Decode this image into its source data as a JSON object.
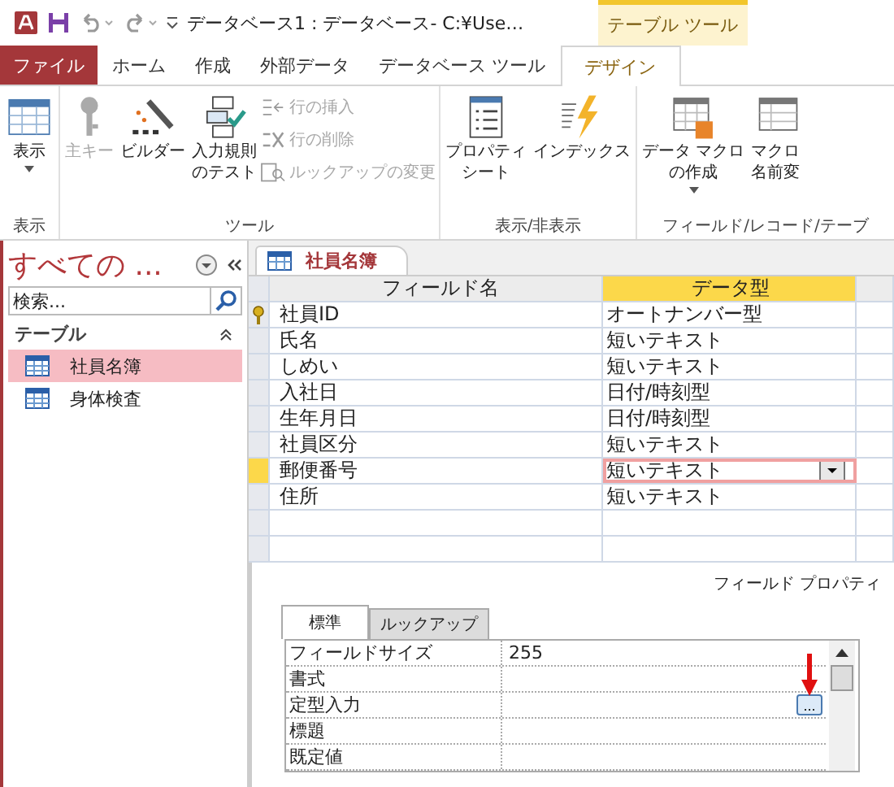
{
  "title_bar": {
    "title": "データベース1 : データベース- C:¥Use…",
    "context_tab": "テーブル ツール"
  },
  "ribbon_tabs": [
    {
      "label": "ファイル",
      "kind": "file",
      "selected": false
    },
    {
      "label": "ホーム",
      "kind": "tab",
      "selected": false
    },
    {
      "label": "作成",
      "kind": "tab",
      "selected": false
    },
    {
      "label": "外部データ",
      "kind": "tab",
      "selected": false
    },
    {
      "label": "データベース ツール",
      "kind": "tab",
      "selected": false
    },
    {
      "label": "デザイン",
      "kind": "tab",
      "selected": true
    }
  ],
  "ribbon_groups": [
    {
      "label": "表示",
      "buttons": [
        {
          "label": [
            "表示"
          ],
          "kind": "large",
          "disabled": false,
          "dropdown": true
        }
      ]
    },
    {
      "label": "ツール",
      "buttons": [
        {
          "label": [
            "主キー"
          ],
          "kind": "large",
          "disabled": true
        },
        {
          "label": [
            "ビルダー"
          ],
          "kind": "large",
          "disabled": false
        },
        {
          "label": [
            "入力規則",
            "のテスト"
          ],
          "kind": "large",
          "disabled": false
        },
        {
          "label": [
            "行の挿入"
          ],
          "kind": "small",
          "disabled": true
        },
        {
          "label": [
            "行の削除"
          ],
          "kind": "small",
          "disabled": true
        },
        {
          "label": [
            "ルックアップの変更"
          ],
          "kind": "small",
          "disabled": true
        }
      ]
    },
    {
      "label": "表示/非表示",
      "buttons": [
        {
          "label": [
            "プロパティ",
            "シート"
          ],
          "kind": "large",
          "disabled": false
        },
        {
          "label": [
            "インデックス"
          ],
          "kind": "large",
          "disabled": false
        }
      ]
    },
    {
      "label": "フィールド/レコード/テーブ",
      "buttons": [
        {
          "label": [
            "データ マクロ",
            "の作成"
          ],
          "kind": "large",
          "disabled": false,
          "dropdown": true
        },
        {
          "label": [
            "マクロ",
            "名前変"
          ],
          "kind": "large",
          "disabled": false
        }
      ]
    }
  ],
  "nav_pane": {
    "title": "すべての ...",
    "search": {
      "placeholder": "検索..."
    },
    "section": "テーブル",
    "items": [
      {
        "label": "社員名簿",
        "selected": true
      },
      {
        "label": "身体検査",
        "selected": false
      }
    ]
  },
  "document_tab": "社員名簿",
  "table": {
    "columns": [
      "フィールド名",
      "データ型"
    ],
    "rows": [
      {
        "field": "社員ID",
        "type": "オートナンバー型",
        "primary_key": true,
        "selected": false
      },
      {
        "field": "氏名",
        "type": "短いテキスト",
        "primary_key": false,
        "selected": false
      },
      {
        "field": "しめい",
        "type": "短いテキスト",
        "primary_key": false,
        "selected": false
      },
      {
        "field": "入社日",
        "type": "日付/時刻型",
        "primary_key": false,
        "selected": false
      },
      {
        "field": "生年月日",
        "type": "日付/時刻型",
        "primary_key": false,
        "selected": false
      },
      {
        "field": "社員区分",
        "type": "短いテキスト",
        "primary_key": false,
        "selected": false
      },
      {
        "field": "郵便番号",
        "type": "短いテキスト",
        "primary_key": false,
        "selected": true
      },
      {
        "field": "住所",
        "type": "短いテキスト",
        "primary_key": false,
        "selected": false
      }
    ]
  },
  "field_properties": {
    "title": "フィールド プロパティ",
    "tabs": [
      {
        "label": "標準",
        "selected": true
      },
      {
        "label": "ルックアップ",
        "selected": false
      }
    ],
    "rows": [
      {
        "name": "フィールドサイズ",
        "value": "255"
      },
      {
        "name": "書式"
      },
      {
        "name": "定型入力",
        "builder": "..."
      },
      {
        "name": "標題"
      },
      {
        "name": "既定値"
      }
    ]
  }
}
